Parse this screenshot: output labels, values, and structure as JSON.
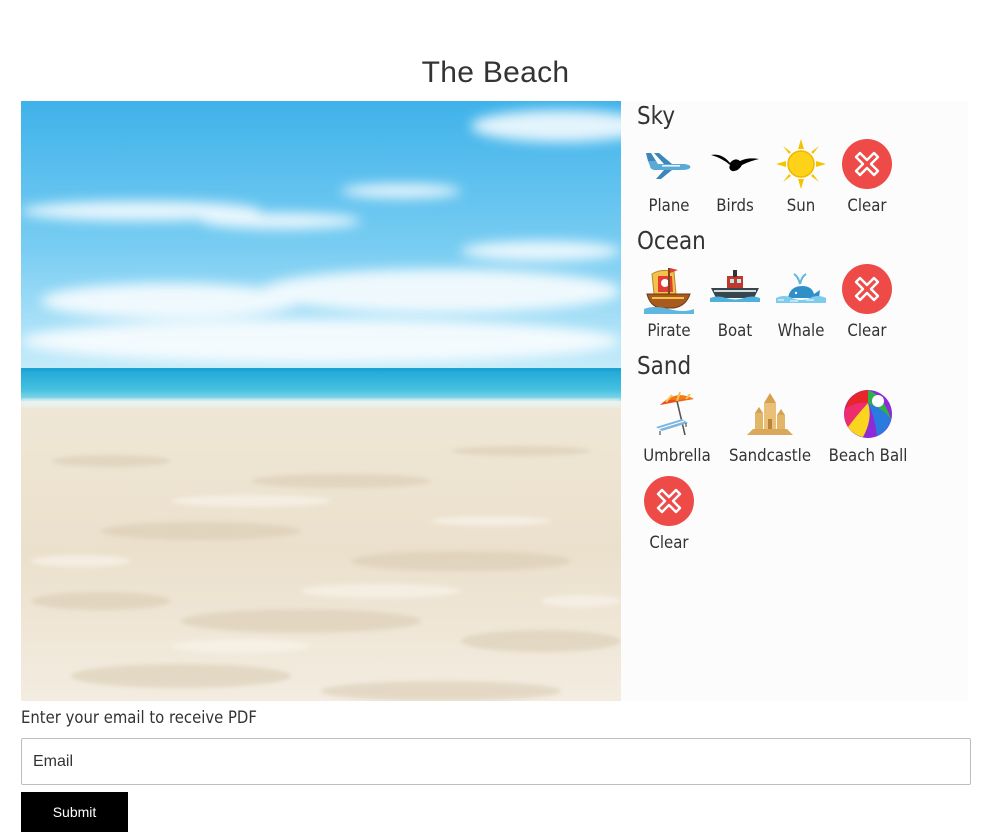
{
  "page": {
    "title": "The Beach"
  },
  "scene": {
    "description_image": "beach-photo"
  },
  "panel": {
    "sections": [
      {
        "title": "Sky",
        "items": [
          {
            "label": "Plane",
            "icon": "plane-icon"
          },
          {
            "label": "Birds",
            "icon": "birds-icon"
          },
          {
            "label": "Sun",
            "icon": "sun-icon"
          },
          {
            "label": "Clear",
            "icon": "clear-icon"
          }
        ]
      },
      {
        "title": "Ocean",
        "items": [
          {
            "label": "Pirate",
            "icon": "pirate-ship-icon"
          },
          {
            "label": "Boat",
            "icon": "boat-icon"
          },
          {
            "label": "Whale",
            "icon": "whale-icon"
          },
          {
            "label": "Clear",
            "icon": "clear-icon"
          }
        ]
      },
      {
        "title": "Sand",
        "items": [
          {
            "label": "Umbrella",
            "icon": "umbrella-icon"
          },
          {
            "label": "Sandcastle",
            "icon": "sandcastle-icon"
          },
          {
            "label": "Beach Ball",
            "icon": "beach-ball-icon"
          },
          {
            "label": "Clear",
            "icon": "clear-icon"
          }
        ]
      }
    ]
  },
  "form": {
    "label": "Enter your email to receive PDF",
    "email_placeholder": "Email",
    "email_value": "",
    "submit_label": "Submit"
  },
  "colors": {
    "clear_button": "#ee4b48",
    "submit_button": "#000000",
    "sky_top": "#4ab8ec",
    "ocean": "#2fb4d9",
    "sand": "#ece3d3"
  }
}
